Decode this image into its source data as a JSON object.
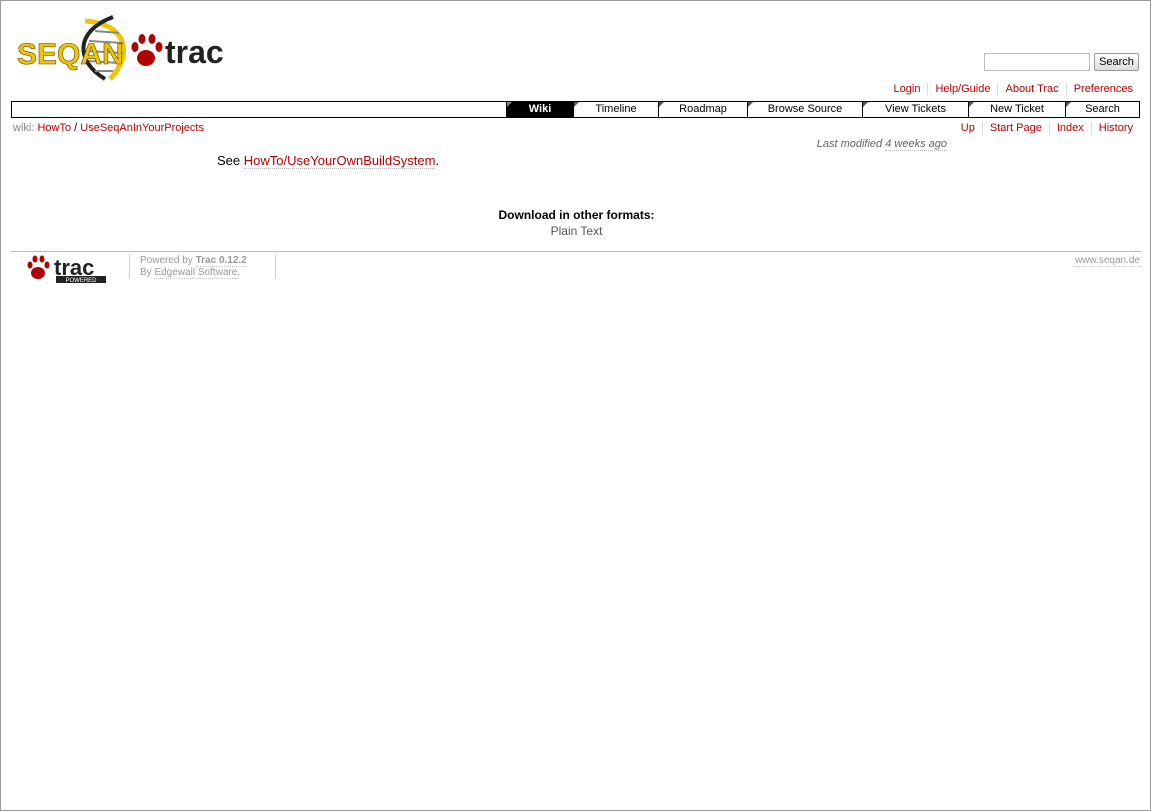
{
  "logo": {
    "text_left": "SEQAN",
    "text_right": "trac"
  },
  "search": {
    "placeholder": "",
    "value": "",
    "button_label": "Search"
  },
  "metanav": [
    {
      "label": "Login"
    },
    {
      "label": "Help/Guide"
    },
    {
      "label": "About Trac"
    },
    {
      "label": "Preferences"
    }
  ],
  "mainnav": [
    {
      "label": "Wiki",
      "active": true
    },
    {
      "label": "Timeline"
    },
    {
      "label": "Roadmap"
    },
    {
      "label": "Browse Source"
    },
    {
      "label": "View Tickets"
    },
    {
      "label": "New Ticket"
    },
    {
      "label": "Search"
    }
  ],
  "breadcrumb": {
    "prefix": "wiki:",
    "items": [
      "HowTo",
      "UseSeqAnInYourProjects"
    ],
    "separator": "/"
  },
  "ctxtnav": [
    {
      "label": "Up"
    },
    {
      "label": "Start Page"
    },
    {
      "label": "Index"
    },
    {
      "label": "History"
    }
  ],
  "last_modified": {
    "prefix": "Last modified",
    "ago": "4 weeks ago"
  },
  "content": {
    "prefix": "See",
    "link": "HowTo/UseYourOwnBuildSystem",
    "suffix": "."
  },
  "download": {
    "title": "Download in other formats:",
    "link": "Plain Text"
  },
  "footer": {
    "logo_text": "trac",
    "logo_badge": "POWERED",
    "powered_prefix": "Powered by",
    "powered_name": "Trac 0.12.2",
    "by_prefix": "By",
    "by_name": "Edgewall Software",
    "right_link": "www.seqan.de"
  },
  "colors": {
    "link": "#bb0000",
    "logo_yellow": "#f0c400",
    "logo_red": "#b00000"
  }
}
